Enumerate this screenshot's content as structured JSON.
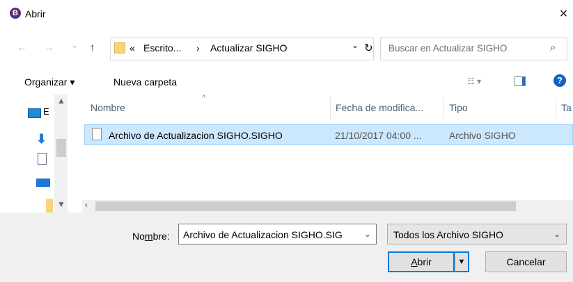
{
  "window": {
    "title": "Abrir",
    "app_icon_letter": "B",
    "close_glyph": "×"
  },
  "nav": {
    "back_glyph": "←",
    "forward_glyph": "→",
    "recent_glyph": "⌄",
    "up_glyph": "↑",
    "breadcrumb": {
      "prefix": "«",
      "items": [
        "Escrito...",
        "Actualizar SIGHO"
      ],
      "separator": "›"
    },
    "dropdown_glyph": "⌄",
    "refresh_glyph": "↻"
  },
  "search": {
    "placeholder": "Buscar en Actualizar SIGHO",
    "icon": "search-icon"
  },
  "toolbar": {
    "organize_label": "Organizar ▾",
    "new_folder_label": "Nueva carpeta",
    "view_glyph": "☷ ▾",
    "help_glyph": "?"
  },
  "nav_pane": {
    "first_item_letter": "E"
  },
  "file_list": {
    "columns": [
      "Nombre",
      "Fecha de modifica...",
      "Tipo",
      "Ta"
    ],
    "sort_glyph": "^",
    "rows": [
      {
        "name": "Archivo de Actualizacion SIGHO.SIGHO",
        "modified": "21/10/2017 04:00 ...",
        "type": "Archivo SIGHO",
        "selected": true
      }
    ]
  },
  "bottom": {
    "name_label_pre": "No",
    "name_label_u": "m",
    "name_label_post": "bre:",
    "filename_value": "Archivo de Actualizacion SIGHO.SIG",
    "filetype_value": "Todos los Archivo SIGHO",
    "open_label_u": "A",
    "open_label_rest": "brir",
    "split_glyph": "▼",
    "cancel_label": "Cancelar"
  },
  "colors": {
    "selection": "#cce8ff",
    "selection_border": "#99d1ff",
    "accent": "#0078d7",
    "footer_bg": "#f0f0f0"
  }
}
